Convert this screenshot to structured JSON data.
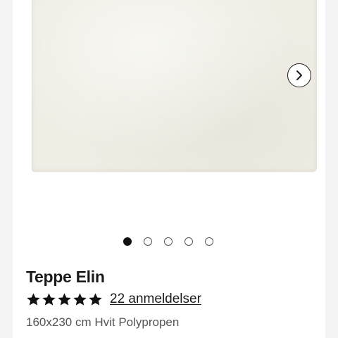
{
  "product": {
    "title": "Teppe Elin",
    "rating": {
      "stars": 5,
      "max_stars": 5,
      "reviews_label": "22 anmeldelser"
    },
    "subtitle": "160x230 cm Hvit Polypropen"
  },
  "gallery": {
    "image_count": 5,
    "active_index": 0,
    "next_icon": "chevron-right-icon"
  },
  "colors": {
    "rug": "#efede4",
    "star": "#111111",
    "text": "#1a1a1a",
    "muted": "#555555"
  }
}
